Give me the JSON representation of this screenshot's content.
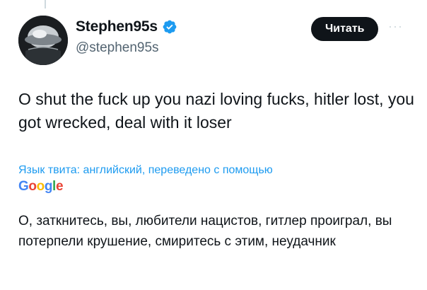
{
  "author": {
    "display_name": "Stephen95s",
    "handle": "@stephen95s",
    "verified": true,
    "avatar_icon": "avatar-photo"
  },
  "follow_button": {
    "label": "Читать"
  },
  "more_menu": {
    "icon": "more-dots-icon",
    "glyph": "···"
  },
  "tweet": {
    "text": "O shut the fuck up you nazi loving fucks, hitler lost, you got wrecked, deal with it loser"
  },
  "translation": {
    "label": "Язык твита: английский, переведено с помощью",
    "provider_letters": [
      "G",
      "o",
      "o",
      "g",
      "l",
      "e"
    ],
    "provider_colors": [
      "#4285f4",
      "#ea4335",
      "#fbbc05",
      "#4285f4",
      "#34a853",
      "#ea4335"
    ],
    "text": "О, заткнитесь, вы, любители нацистов, гитлер проиграл, вы потерпели крушение, смиритесь с этим, неудачник"
  },
  "colors": {
    "accent": "#1d9bf0",
    "text_primary": "#0f1419",
    "text_secondary": "#536471",
    "button_bg": "#0f1419"
  }
}
